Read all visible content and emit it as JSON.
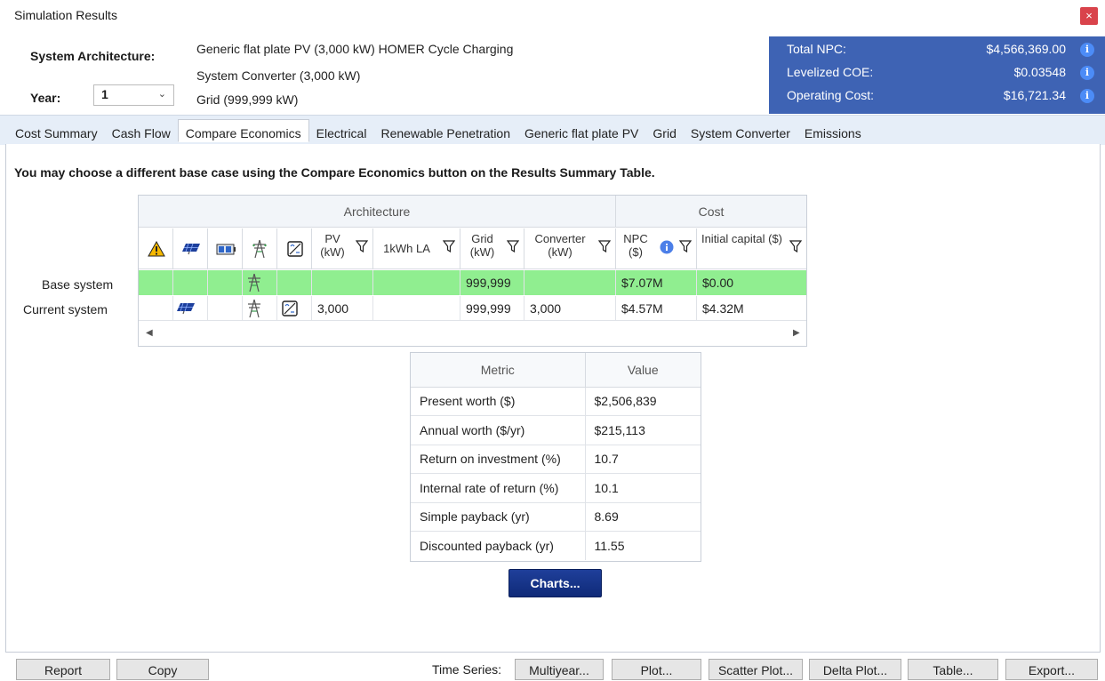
{
  "window": {
    "title": "Simulation Results",
    "close_glyph": "×"
  },
  "header": {
    "arch_label": "System Architecture:",
    "year_label": "Year:",
    "year_value": "1",
    "arch_lines": [
      "Generic flat plate PV (3,000 kW)  HOMER Cycle Charging",
      "System Converter (3,000 kW)",
      "Grid (999,999 kW)"
    ]
  },
  "summary": {
    "rows": [
      {
        "label": "Total NPC:",
        "value": "$4,566,369.00"
      },
      {
        "label": "Levelized COE:",
        "value": "$0.03548"
      },
      {
        "label": "Operating Cost:",
        "value": "$16,721.34"
      }
    ],
    "info_glyph": "i"
  },
  "tabs": [
    "Cost Summary",
    "Cash Flow",
    "Compare Economics",
    "Electrical",
    "Renewable Penetration",
    "Generic flat plate PV",
    "Grid",
    "System Converter",
    "Emissions"
  ],
  "active_tab": "Compare Economics",
  "note": "You may choose a different base case using the Compare Economics button on the Results Summary Table.",
  "grid": {
    "group_architecture": "Architecture",
    "group_cost": "Cost",
    "columns": {
      "pv": "PV (kW)",
      "la": "1kWh LA",
      "grid": "Grid (kW)",
      "converter": "Converter (kW)",
      "npc": "NPC ($)",
      "capital": "Initial capital ($)"
    },
    "rows": [
      {
        "label": "Base system",
        "pv": "",
        "la": "",
        "grid": "999,999",
        "converter": "",
        "npc": "$7.07M",
        "capital": "$0.00"
      },
      {
        "label": "Current system",
        "pv": "3,000",
        "la": "",
        "grid": "999,999",
        "converter": "3,000",
        "npc": "$4.57M",
        "capital": "$4.32M"
      }
    ],
    "base_row_color": "#90ee90"
  },
  "metrics": {
    "header_metric": "Metric",
    "header_value": "Value",
    "rows": [
      {
        "metric": "Present worth ($)",
        "value": "$2,506,839"
      },
      {
        "metric": "Annual worth ($/yr)",
        "value": "$215,113"
      },
      {
        "metric": "Return on investment (%)",
        "value": "10.7"
      },
      {
        "metric": "Internal rate of return (%)",
        "value": "10.1"
      },
      {
        "metric": "Simple payback (yr)",
        "value": "8.69"
      },
      {
        "metric": "Discounted payback (yr)",
        "value": "11.55"
      }
    ]
  },
  "charts_button": "Charts...",
  "bottom": {
    "report": "Report",
    "copy": "Copy",
    "time_series_label": "Time Series:",
    "multiyear": "Multiyear...",
    "plot": "Plot...",
    "scatter": "Scatter Plot...",
    "delta": "Delta Plot...",
    "table": "Table...",
    "export": "Export..."
  },
  "colors": {
    "summary_bg": "#3e63b4",
    "accent_button": "#1f3f9a",
    "close": "#d9434b"
  }
}
